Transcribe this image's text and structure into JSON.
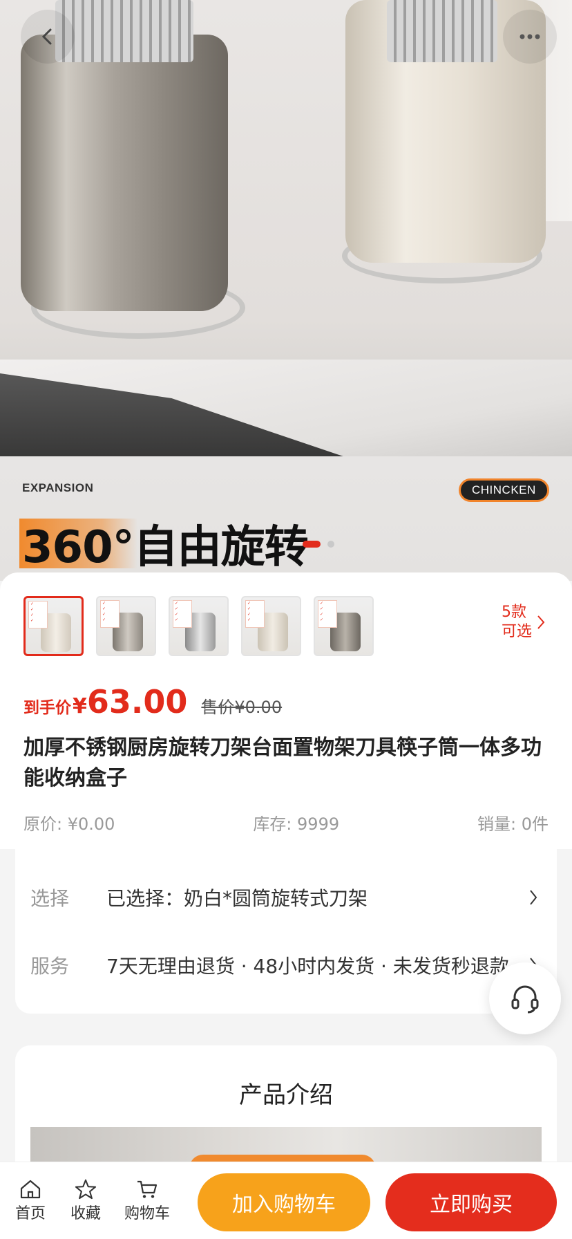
{
  "hero": {
    "expansion_label": "EXPANSION",
    "brand": "CHINCKEN",
    "banner_text": "360°自由旋转",
    "dots_count": 2,
    "active_dot": 0
  },
  "nav": {
    "back_icon": "chevron-left-icon",
    "more_icon": "more-dots-icon"
  },
  "variants": {
    "thumbnails": [
      {
        "color": "cream",
        "selected": true
      },
      {
        "color": "steel",
        "selected": false
      },
      {
        "color": "silver",
        "selected": false
      },
      {
        "color": "cream",
        "selected": false
      },
      {
        "color": "steel-dark",
        "selected": false
      }
    ],
    "count_line1": "5款",
    "count_line2": "可选"
  },
  "price": {
    "label": "到手价",
    "currency": "¥",
    "value": "63.00",
    "sale_price": "售价¥0.00"
  },
  "product": {
    "title": "加厚不锈钢厨房旋转刀架台面置物架刀具筷子筒一体多功能收纳盒子"
  },
  "stats": {
    "original_price": "原价: ¥0.00",
    "stock": "库存: 9999",
    "sales": "销量: 0件"
  },
  "options": {
    "select_key": "选择",
    "select_value": "已选择：奶白*圆筒旋转式刀架",
    "service_key": "服务",
    "service_value": "7天无理由退货 · 48小时内发货 · 未发货秒退款"
  },
  "intro": {
    "title": "产品介绍"
  },
  "bottom": {
    "home": "首页",
    "favorite": "收藏",
    "cart": "购物车",
    "add_to_cart": "加入购物车",
    "buy_now": "立即购买"
  },
  "colors": {
    "accent_red": "#e22b1b",
    "accent_orange": "#f7a21b",
    "background": "#f4f4f4"
  }
}
